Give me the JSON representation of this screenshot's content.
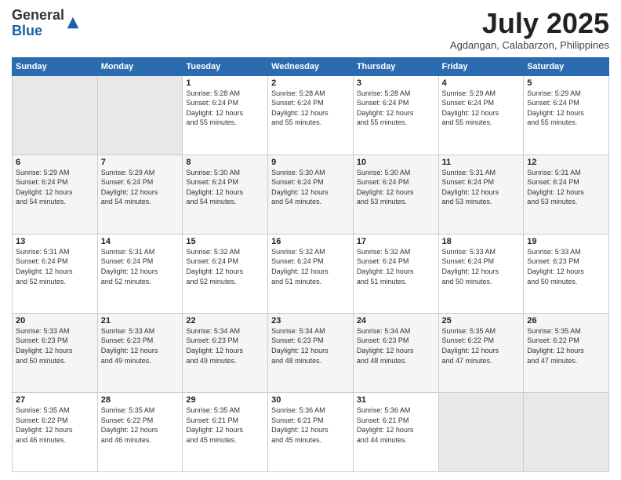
{
  "logo": {
    "general": "General",
    "blue": "Blue"
  },
  "header": {
    "month": "July 2025",
    "location": "Agdangan, Calabarzon, Philippines"
  },
  "weekdays": [
    "Sunday",
    "Monday",
    "Tuesday",
    "Wednesday",
    "Thursday",
    "Friday",
    "Saturday"
  ],
  "weeks": [
    [
      {
        "day": "",
        "info": ""
      },
      {
        "day": "",
        "info": ""
      },
      {
        "day": "1",
        "info": "Sunrise: 5:28 AM\nSunset: 6:24 PM\nDaylight: 12 hours\nand 55 minutes."
      },
      {
        "day": "2",
        "info": "Sunrise: 5:28 AM\nSunset: 6:24 PM\nDaylight: 12 hours\nand 55 minutes."
      },
      {
        "day": "3",
        "info": "Sunrise: 5:28 AM\nSunset: 6:24 PM\nDaylight: 12 hours\nand 55 minutes."
      },
      {
        "day": "4",
        "info": "Sunrise: 5:29 AM\nSunset: 6:24 PM\nDaylight: 12 hours\nand 55 minutes."
      },
      {
        "day": "5",
        "info": "Sunrise: 5:29 AM\nSunset: 6:24 PM\nDaylight: 12 hours\nand 55 minutes."
      }
    ],
    [
      {
        "day": "6",
        "info": "Sunrise: 5:29 AM\nSunset: 6:24 PM\nDaylight: 12 hours\nand 54 minutes."
      },
      {
        "day": "7",
        "info": "Sunrise: 5:29 AM\nSunset: 6:24 PM\nDaylight: 12 hours\nand 54 minutes."
      },
      {
        "day": "8",
        "info": "Sunrise: 5:30 AM\nSunset: 6:24 PM\nDaylight: 12 hours\nand 54 minutes."
      },
      {
        "day": "9",
        "info": "Sunrise: 5:30 AM\nSunset: 6:24 PM\nDaylight: 12 hours\nand 54 minutes."
      },
      {
        "day": "10",
        "info": "Sunrise: 5:30 AM\nSunset: 6:24 PM\nDaylight: 12 hours\nand 53 minutes."
      },
      {
        "day": "11",
        "info": "Sunrise: 5:31 AM\nSunset: 6:24 PM\nDaylight: 12 hours\nand 53 minutes."
      },
      {
        "day": "12",
        "info": "Sunrise: 5:31 AM\nSunset: 6:24 PM\nDaylight: 12 hours\nand 53 minutes."
      }
    ],
    [
      {
        "day": "13",
        "info": "Sunrise: 5:31 AM\nSunset: 6:24 PM\nDaylight: 12 hours\nand 52 minutes."
      },
      {
        "day": "14",
        "info": "Sunrise: 5:31 AM\nSunset: 6:24 PM\nDaylight: 12 hours\nand 52 minutes."
      },
      {
        "day": "15",
        "info": "Sunrise: 5:32 AM\nSunset: 6:24 PM\nDaylight: 12 hours\nand 52 minutes."
      },
      {
        "day": "16",
        "info": "Sunrise: 5:32 AM\nSunset: 6:24 PM\nDaylight: 12 hours\nand 51 minutes."
      },
      {
        "day": "17",
        "info": "Sunrise: 5:32 AM\nSunset: 6:24 PM\nDaylight: 12 hours\nand 51 minutes."
      },
      {
        "day": "18",
        "info": "Sunrise: 5:33 AM\nSunset: 6:24 PM\nDaylight: 12 hours\nand 50 minutes."
      },
      {
        "day": "19",
        "info": "Sunrise: 5:33 AM\nSunset: 6:23 PM\nDaylight: 12 hours\nand 50 minutes."
      }
    ],
    [
      {
        "day": "20",
        "info": "Sunrise: 5:33 AM\nSunset: 6:23 PM\nDaylight: 12 hours\nand 50 minutes."
      },
      {
        "day": "21",
        "info": "Sunrise: 5:33 AM\nSunset: 6:23 PM\nDaylight: 12 hours\nand 49 minutes."
      },
      {
        "day": "22",
        "info": "Sunrise: 5:34 AM\nSunset: 6:23 PM\nDaylight: 12 hours\nand 49 minutes."
      },
      {
        "day": "23",
        "info": "Sunrise: 5:34 AM\nSunset: 6:23 PM\nDaylight: 12 hours\nand 48 minutes."
      },
      {
        "day": "24",
        "info": "Sunrise: 5:34 AM\nSunset: 6:23 PM\nDaylight: 12 hours\nand 48 minutes."
      },
      {
        "day": "25",
        "info": "Sunrise: 5:35 AM\nSunset: 6:22 PM\nDaylight: 12 hours\nand 47 minutes."
      },
      {
        "day": "26",
        "info": "Sunrise: 5:35 AM\nSunset: 6:22 PM\nDaylight: 12 hours\nand 47 minutes."
      }
    ],
    [
      {
        "day": "27",
        "info": "Sunrise: 5:35 AM\nSunset: 6:22 PM\nDaylight: 12 hours\nand 46 minutes."
      },
      {
        "day": "28",
        "info": "Sunrise: 5:35 AM\nSunset: 6:22 PM\nDaylight: 12 hours\nand 46 minutes."
      },
      {
        "day": "29",
        "info": "Sunrise: 5:35 AM\nSunset: 6:21 PM\nDaylight: 12 hours\nand 45 minutes."
      },
      {
        "day": "30",
        "info": "Sunrise: 5:36 AM\nSunset: 6:21 PM\nDaylight: 12 hours\nand 45 minutes."
      },
      {
        "day": "31",
        "info": "Sunrise: 5:36 AM\nSunset: 6:21 PM\nDaylight: 12 hours\nand 44 minutes."
      },
      {
        "day": "",
        "info": ""
      },
      {
        "day": "",
        "info": ""
      }
    ]
  ]
}
